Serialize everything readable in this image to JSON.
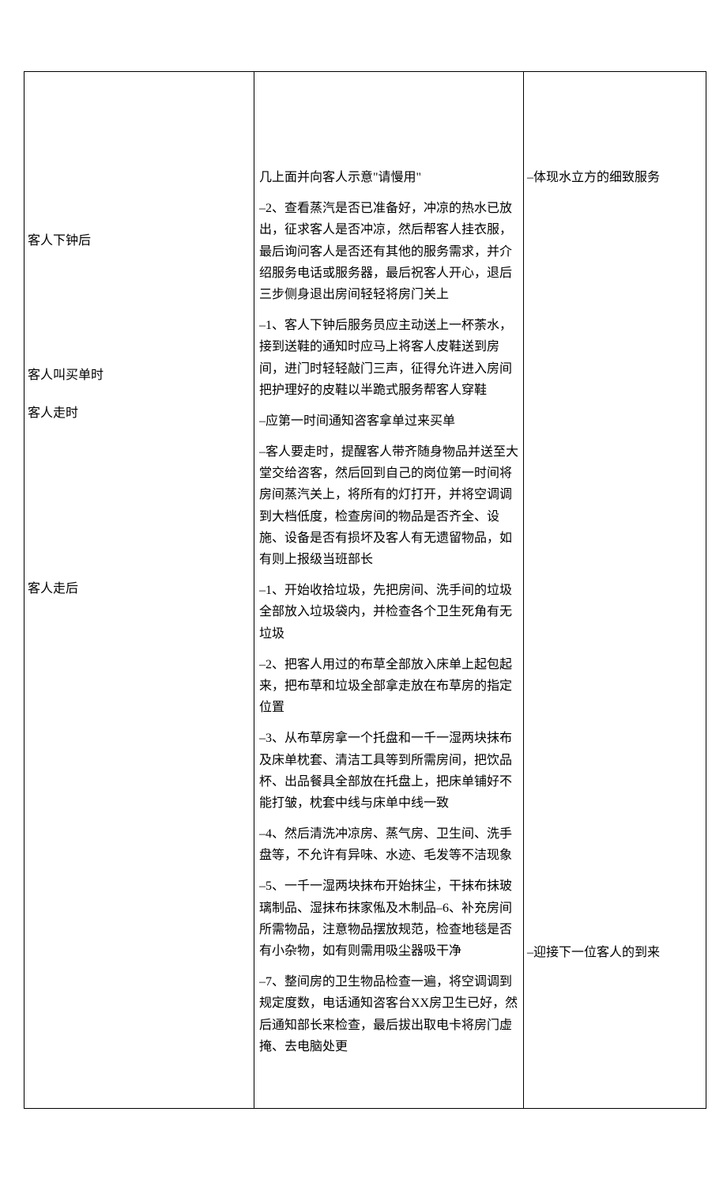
{
  "left_labels": {
    "item1": "客人下钟后",
    "item2": "客人叫买单时",
    "item3": "客人走时",
    "item4": "客人走后"
  },
  "right_labels": {
    "r1": "–体现水立方的细致服务",
    "r2": "–迎接下一位客人的到来"
  },
  "center_blocks": {
    "b1": "几上面并向客人示意\"请慢用\"",
    "b2": "–2、查看蒸汽是否已准备好，冲凉的热水已放出，征求客人是否冲凉，然后帮客人挂衣服，最后询问客人是否还有其他的服务需求，并介绍服务电话或服务器，最后祝客人开心，退后三步侧身退出房间轻轻将房门关上",
    "b3": "–1、客人下钟后服务员应主动送上一杯荼水，接到送鞋的通知时应马上将客人皮鞋送到房间，进门时轻轻敲门三声，征得允许进入房间把护理好的皮鞋以半跪式服务帮客人穿鞋",
    "b4": "–应第一时间通知咨客拿单过来买单",
    "b5": "–客人要走时，提醒客人带齐随身物品并送至大堂交给咨客，然后回到自己的岗位第一时间将房间蒸汽关上，将所有的灯打开，并将空调调到大档低度，检查房间的物品是否齐全、设施、设备是否有损坏及客人有无遗留物品，如有则上报级当班部长",
    "b6": "–1、开始收拾垃圾，先把房间、洗手间的垃圾全部放入垃圾袋内，并检查各个卫生死角有无垃圾",
    "b7": "–2、把客人用过的布草全部放入床单上起包起来，把布草和垃圾全部拿走放在布草房的指定位置",
    "b8": "–3、从布草房拿一个托盘和一千一湿两块抹布及床单枕套、清洁工具等到所需房间，把饮品杯、出品餐具全部放在托盘上，把床单铺好不能打皱，枕套中线与床单中线一致",
    "b9": "–4、然后清洗冲凉房、蒸气房、卫生间、洗手盘等，不允许有异味、水迹、毛发等不洁现象",
    "b10": "–5、一千一湿两块抹布开始抹尘，干抹布抹玻璃制品、湿抹布抹家俬及木制品–6、补充房间所需物品，注意物品摆放规范，检查地毯是否有小杂物，如有则需用吸尘器吸干净",
    "b11": "–7、整间房的卫生物品检查一遍，将空调调到规定度数，电话通知咨客台XX房卫生已好，然后通知部长来检查，最后拔出取电卡将房门虚掩、去电脑处更"
  }
}
